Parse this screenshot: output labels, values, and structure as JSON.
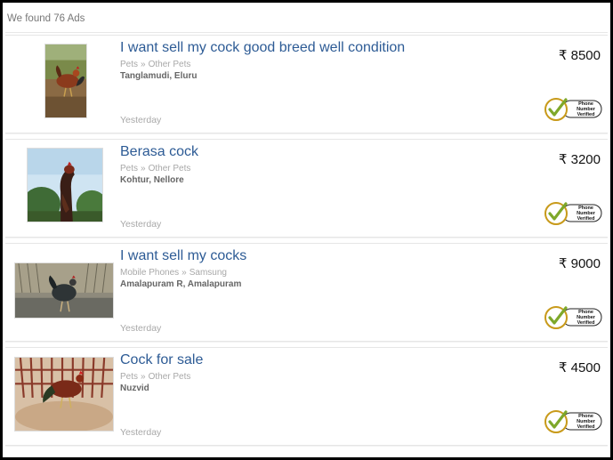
{
  "results": {
    "summary": "We found 76 Ads"
  },
  "badge": {
    "line1": "Phone",
    "line2": "Number",
    "line3": "Verified"
  },
  "ads": [
    {
      "title": "I want sell my cock good breed well condition",
      "category": "Pets",
      "subcategory": "Other Pets",
      "location": "Tanglamudi, Eluru",
      "date": "Yesterday",
      "price": "₹ 8500"
    },
    {
      "title": "Berasa cock",
      "category": "Pets",
      "subcategory": "Other Pets",
      "location": "Kohtur, Nellore",
      "date": "Yesterday",
      "price": "₹ 3200"
    },
    {
      "title": "I want sell my cocks",
      "category": "Mobile Phones",
      "subcategory": "Samsung",
      "location": "Amalapuram R, Amalapuram",
      "date": "Yesterday",
      "price": "₹ 9000"
    },
    {
      "title": "Cock for sale",
      "category": "Pets",
      "subcategory": "Other Pets",
      "location": "Nuzvid",
      "date": "Yesterday",
      "price": "₹ 4500"
    }
  ]
}
